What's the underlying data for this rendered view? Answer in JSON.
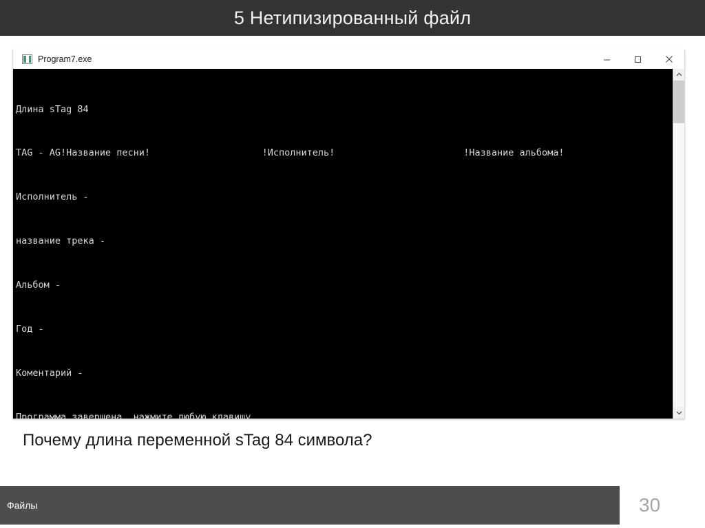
{
  "slide": {
    "header_title": "5 Нетипизированный файл",
    "header_bg": "#333333",
    "question": "Почему длина переменной sTag 84 символа?"
  },
  "console_window": {
    "title": "Program7.exe",
    "icon": "console-app-icon",
    "buttons": {
      "minimize": "minimize-icon",
      "maximize": "maximize-icon",
      "close": "close-icon"
    },
    "background": "#000000",
    "foreground": "#d6d6d6",
    "lines": [
      "Длина sTag 84",
      "TAG - AG!Название песни!                    !Исполнитель!                       !Название альбома!",
      "Исполнитель -",
      "название трека -",
      "Альбом -",
      "Год -",
      "Коментарий -",
      "Программа завершена, нажмите любую клавишу . . ."
    ],
    "scrollbar": {
      "up_arrow": "chevron-up-icon",
      "down_arrow": "chevron-down-icon"
    }
  },
  "footer": {
    "label": "Файлы",
    "page_number": "30",
    "bar_color": "#4d4d4d"
  }
}
